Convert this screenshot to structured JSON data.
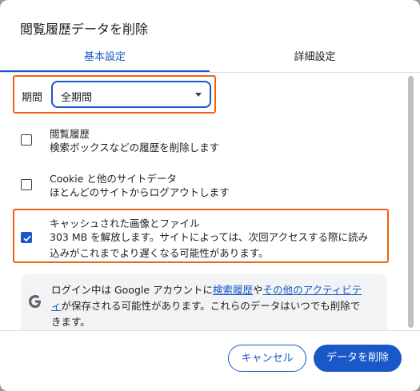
{
  "dialog": {
    "title": "閲覧履歴データを削除"
  },
  "tabs": [
    {
      "label": "基本設定",
      "active": true
    },
    {
      "label": "詳細設定",
      "active": false
    }
  ],
  "period": {
    "label": "期間",
    "value": "全期間"
  },
  "options": [
    {
      "title": "閲覧履歴",
      "desc": "検索ボックスなどの履歴を削除します",
      "checked": false
    },
    {
      "title": "Cookie と他のサイトデータ",
      "desc": "ほとんどのサイトからログアウトします",
      "checked": false
    },
    {
      "title": "キャッシュされた画像とファイル",
      "desc_line1": "303 MB を解放します。サイトによっては、次回アクセスする際に読み",
      "desc_line2": "込みがこれまでより遅くなる可能性があります。",
      "checked": true
    }
  ],
  "info": {
    "text_1": "ログイン中は Google アカウントに",
    "link_1": "検索履歴",
    "text_2": "や",
    "link_2a": "その他のアクティビテ",
    "link_2b": "ィ",
    "text_3": "が保存される可能性があります。これらのデータはいつでも削除で",
    "text_4": "きます。",
    "icon": "google-g-icon"
  },
  "footer": {
    "cancel_label": "キャンセル",
    "delete_label": "データを削除"
  },
  "colors": {
    "accent": "#1a57c8",
    "highlight": "#f0620f"
  }
}
